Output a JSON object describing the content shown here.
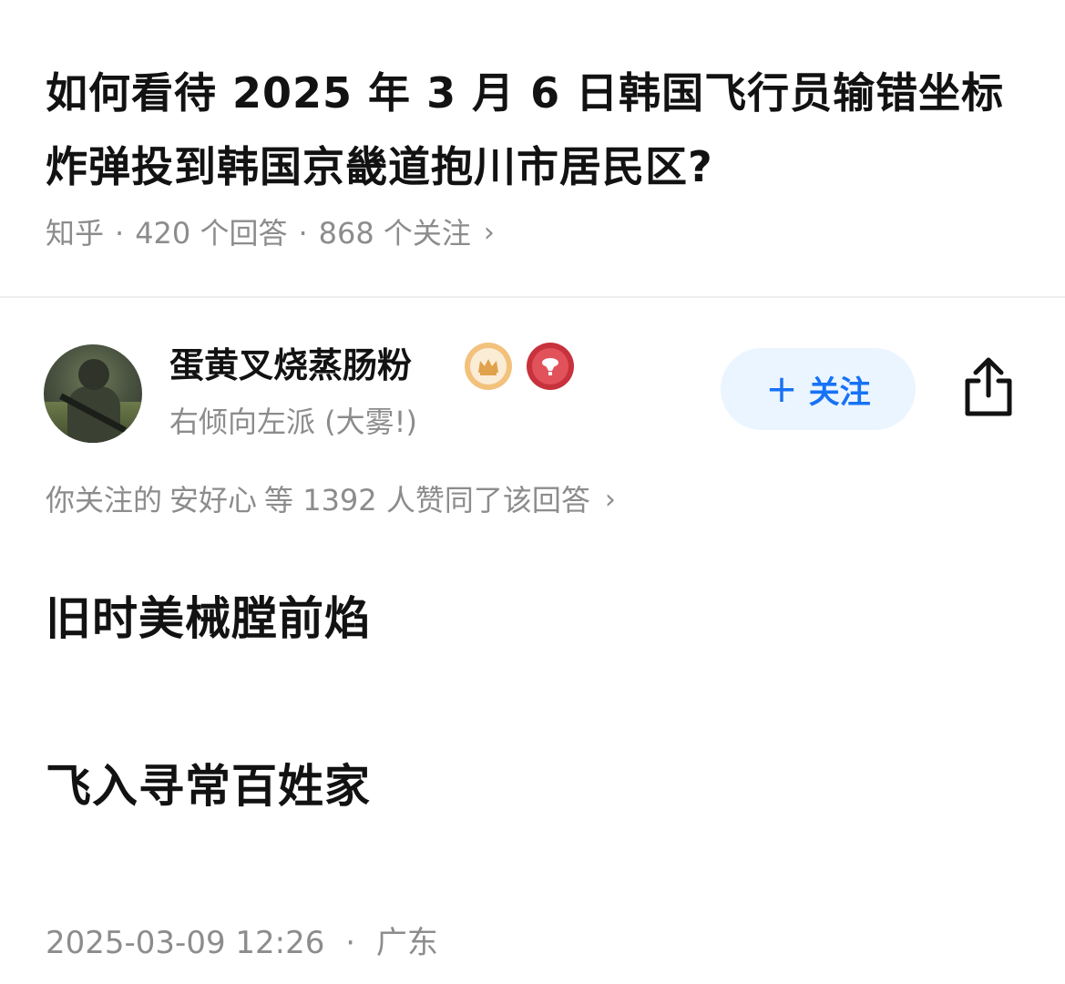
{
  "question": {
    "title": "如何看待 2025 年 3 月 6 日韩国飞行员输错坐标炸弹投到韩国京畿道抱川市居民区?",
    "source": "知乎",
    "separator": "·",
    "answers": "420 个回答",
    "followers": "868 个关注",
    "chevron": "›"
  },
  "author": {
    "name": "蛋黄叉烧蒸肠粉",
    "bio": "右倾向左派 (大雾!)",
    "badges": [
      "crown-badge-icon",
      "red-badge-icon"
    ],
    "follow_plus": "+",
    "follow_label": "关注",
    "share_icon": "share-icon"
  },
  "endorse": {
    "prefix": "你关注的",
    "user": "安好心",
    "suffix": "等 1392 人赞同了该回答",
    "chevron": "›"
  },
  "answer": {
    "lines": [
      "旧时美械膛前焰",
      "飞入寻常百姓家"
    ],
    "date": "2025-03-09 12:26",
    "separator": "·",
    "location": "广东"
  },
  "colors": {
    "text_primary": "#121212",
    "text_secondary": "#8c8c8c",
    "accent": "#1772f6",
    "follow_bg": "#ebf5ff"
  }
}
